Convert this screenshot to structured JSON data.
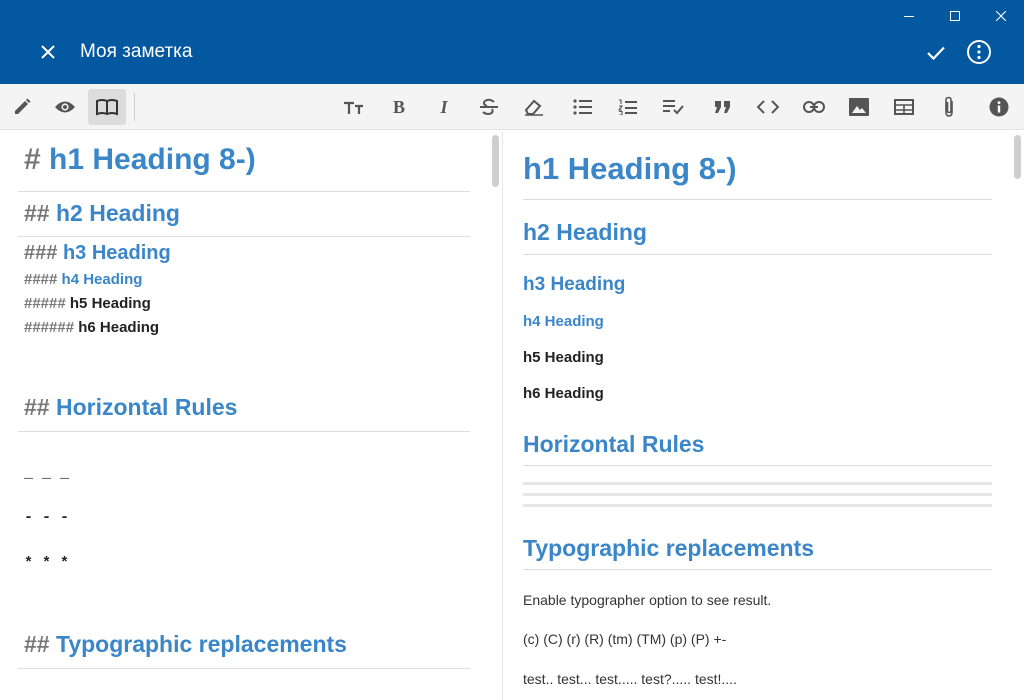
{
  "window": {
    "title": "Моя заметка",
    "accent": "#0358a0",
    "heading_color": "#3a86c8"
  },
  "toolbar": {
    "left": [
      {
        "name": "edit-icon",
        "active": false
      },
      {
        "name": "preview-icon",
        "active": false
      },
      {
        "name": "book-icon",
        "active": true
      }
    ],
    "right": [
      "text-size-icon",
      "bold-icon",
      "italic-icon",
      "strikethrough-icon",
      "eraser-icon",
      "bulleted-list-icon",
      "numbered-list-icon",
      "checklist-icon",
      "quote-icon",
      "code-icon",
      "link-icon",
      "image-icon",
      "table-icon",
      "attachment-icon",
      "info-icon"
    ],
    "bold_letter": "B",
    "italic_letter": "I"
  },
  "editor": {
    "h1": {
      "mark": "#",
      "text": "h1 Heading 8-)"
    },
    "h2": {
      "mark": "##",
      "text": "h2 Heading"
    },
    "h3": {
      "mark": "###",
      "text": "h3 Heading"
    },
    "h4": {
      "mark": "####",
      "text": "h4 Heading"
    },
    "h5": {
      "mark": "#####",
      "text": "h5 Heading"
    },
    "h6": {
      "mark": "######",
      "text": "h6 Heading"
    },
    "hr_title": {
      "mark": "##",
      "text": "Horizontal Rules"
    },
    "hr_lines": [
      "_ _ _",
      "- - -",
      "* * *"
    ],
    "typo_title": {
      "mark": "##",
      "text": "Typographic replacements"
    }
  },
  "preview": {
    "h1": "h1 Heading 8-)",
    "h2": "h2 Heading",
    "h3": "h3 Heading",
    "h4": "h4 Heading",
    "h5": "h5 Heading",
    "h6": "h6 Heading",
    "hr_title": "Horizontal Rules",
    "typo_title": "Typographic replacements",
    "p1": "Enable typographer option to see result.",
    "p2": "(c) (C) (r) (R) (tm) (TM) (p) (P) +-",
    "p3": "test.. test... test..... test?..... test!...."
  }
}
